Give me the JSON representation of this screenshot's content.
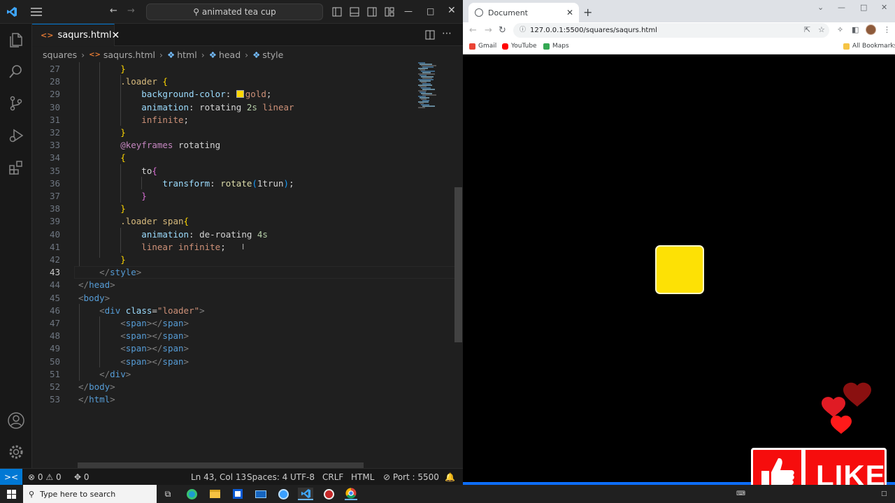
{
  "vscode": {
    "command_center": "animated tea cup",
    "tab": {
      "icon": "<>",
      "label": "saqurs.html"
    },
    "breadcrumb": [
      "squares",
      "saqurs.html",
      "html",
      "head",
      "style"
    ],
    "status": {
      "remote": "><",
      "errors": "0",
      "warnings": "0",
      "ports": "0",
      "position": "Ln 43, Col 13",
      "spaces": "Spaces: 4",
      "encoding": "UTF-8",
      "eol": "CRLF",
      "language": "HTML",
      "port": "Port : 5500"
    },
    "current_line": "43",
    "lines": [
      {
        "n": "27",
        "t": [
          {
            "c": "b1",
            "s": "        }"
          }
        ]
      },
      {
        "n": "28",
        "t": [
          {
            "c": "sel",
            "s": "        .loader "
          },
          {
            "c": "b1",
            "s": "{"
          }
        ]
      },
      {
        "n": "29",
        "t": [
          {
            "c": "pr",
            "s": "            background-color"
          },
          {
            "c": "tx",
            "s": ": "
          },
          {
            "c": "swatch",
            "s": ""
          },
          {
            "c": "vl",
            "s": "gold"
          },
          {
            "c": "tx",
            "s": ";"
          }
        ]
      },
      {
        "n": "30",
        "t": [
          {
            "c": "pr",
            "s": "            animation"
          },
          {
            "c": "tx",
            "s": ": "
          },
          {
            "c": "tx",
            "s": "rotating "
          },
          {
            "c": "nm",
            "s": "2s "
          },
          {
            "c": "vl",
            "s": "linear"
          }
        ]
      },
      {
        "n": "31",
        "t": [
          {
            "c": "vl",
            "s": "            infinite"
          },
          {
            "c": "tx",
            "s": ";"
          }
        ]
      },
      {
        "n": "32",
        "t": [
          {
            "c": "b1",
            "s": "        }"
          }
        ]
      },
      {
        "n": "33",
        "t": [
          {
            "c": "kw",
            "s": "        @keyframes "
          },
          {
            "c": "tx",
            "s": "rotating"
          }
        ]
      },
      {
        "n": "34",
        "t": [
          {
            "c": "b1",
            "s": "        {"
          }
        ]
      },
      {
        "n": "35",
        "t": [
          {
            "c": "tx",
            "s": "            to"
          },
          {
            "c": "b2",
            "s": "{"
          }
        ]
      },
      {
        "n": "36",
        "t": [
          {
            "c": "pr",
            "s": "                transform"
          },
          {
            "c": "tx",
            "s": ": "
          },
          {
            "c": "fn",
            "s": "rotate"
          },
          {
            "c": "b3",
            "s": "("
          },
          {
            "c": "tx",
            "s": "1trun"
          },
          {
            "c": "b3",
            "s": ")"
          },
          {
            "c": "tx",
            "s": ";"
          }
        ]
      },
      {
        "n": "37",
        "t": [
          {
            "c": "b2",
            "s": "            }"
          }
        ]
      },
      {
        "n": "38",
        "t": [
          {
            "c": "b1",
            "s": "        }"
          }
        ]
      },
      {
        "n": "39",
        "t": [
          {
            "c": "sel",
            "s": "        .loader span"
          },
          {
            "c": "b1",
            "s": "{"
          }
        ]
      },
      {
        "n": "40",
        "t": [
          {
            "c": "pr",
            "s": "            animation"
          },
          {
            "c": "tx",
            "s": ": "
          },
          {
            "c": "tx",
            "s": "de-roating "
          },
          {
            "c": "nm",
            "s": "4s"
          }
        ]
      },
      {
        "n": "41",
        "t": [
          {
            "c": "vl",
            "s": "            linear infinite"
          },
          {
            "c": "tx",
            "s": ";"
          }
        ]
      },
      {
        "n": "42",
        "t": [
          {
            "c": "b1",
            "s": "        }"
          }
        ]
      },
      {
        "n": "43",
        "t": [
          {
            "c": "tag",
            "s": "    </"
          },
          {
            "c": "tn",
            "s": "style"
          },
          {
            "c": "tag",
            "s": ">"
          }
        ]
      },
      {
        "n": "44",
        "t": [
          {
            "c": "tag",
            "s": "</"
          },
          {
            "c": "tn",
            "s": "head"
          },
          {
            "c": "tag",
            "s": ">"
          }
        ]
      },
      {
        "n": "45",
        "t": [
          {
            "c": "tag",
            "s": "<"
          },
          {
            "c": "tn",
            "s": "body"
          },
          {
            "c": "tag",
            "s": ">"
          }
        ]
      },
      {
        "n": "46",
        "t": [
          {
            "c": "tag",
            "s": "    <"
          },
          {
            "c": "tn",
            "s": "div "
          },
          {
            "c": "at",
            "s": "class"
          },
          {
            "c": "tx",
            "s": "="
          },
          {
            "c": "av",
            "s": "\"loader\""
          },
          {
            "c": "tag",
            "s": ">"
          }
        ]
      },
      {
        "n": "47",
        "t": [
          {
            "c": "tag",
            "s": "        <"
          },
          {
            "c": "tn",
            "s": "span"
          },
          {
            "c": "tag",
            "s": "></"
          },
          {
            "c": "tn",
            "s": "span"
          },
          {
            "c": "tag",
            "s": ">"
          }
        ]
      },
      {
        "n": "48",
        "t": [
          {
            "c": "tag",
            "s": "        <"
          },
          {
            "c": "tn",
            "s": "span"
          },
          {
            "c": "tag",
            "s": "></"
          },
          {
            "c": "tn",
            "s": "span"
          },
          {
            "c": "tag",
            "s": ">"
          }
        ]
      },
      {
        "n": "49",
        "t": [
          {
            "c": "tag",
            "s": "        <"
          },
          {
            "c": "tn",
            "s": "span"
          },
          {
            "c": "tag",
            "s": "></"
          },
          {
            "c": "tn",
            "s": "span"
          },
          {
            "c": "tag",
            "s": ">"
          }
        ]
      },
      {
        "n": "50",
        "t": [
          {
            "c": "tag",
            "s": "        <"
          },
          {
            "c": "tn",
            "s": "span"
          },
          {
            "c": "tag",
            "s": "></"
          },
          {
            "c": "tn",
            "s": "span"
          },
          {
            "c": "tag",
            "s": ">"
          }
        ]
      },
      {
        "n": "51",
        "t": [
          {
            "c": "tag",
            "s": "    </"
          },
          {
            "c": "tn",
            "s": "div"
          },
          {
            "c": "tag",
            "s": ">"
          }
        ]
      },
      {
        "n": "52",
        "t": [
          {
            "c": "tag",
            "s": "</"
          },
          {
            "c": "tn",
            "s": "body"
          },
          {
            "c": "tag",
            "s": ">"
          }
        ]
      },
      {
        "n": "53",
        "t": [
          {
            "c": "tag",
            "s": "</"
          },
          {
            "c": "tn",
            "s": "html"
          },
          {
            "c": "tag",
            "s": ">"
          }
        ]
      }
    ]
  },
  "chrome": {
    "tab_title": "Document",
    "url": "127.0.0.1:5500/squares/saqurs.html",
    "bookmarks": [
      "Gmail",
      "YouTube",
      "Maps"
    ],
    "all_bookmarks": "All Bookmarks",
    "loader_color": "#fde105"
  },
  "overlay": {
    "like_label": "LIKE",
    "accent": "#f60d0d"
  },
  "taskbar": {
    "search_placeholder": "Type here to search"
  },
  "colors": {
    "vscode_accent": "#0078d4",
    "editor_bg": "#1f1f1f"
  }
}
